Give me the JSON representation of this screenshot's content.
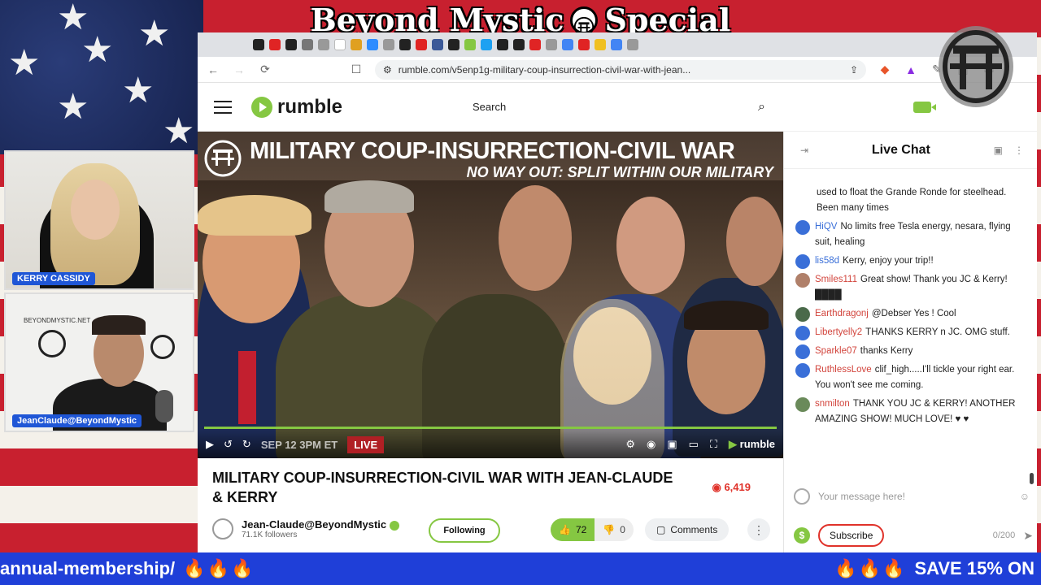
{
  "stream": {
    "title_left": "Beyond Mystic",
    "title_right": "Special Report",
    "ticker_left": "annual-membership/",
    "ticker_left_emoji": "🔥🔥🔥",
    "ticker_right_emoji": "🔥🔥🔥",
    "ticker_right": "SAVE 15% ON"
  },
  "cams": [
    {
      "label": "KERRY CASSIDY"
    },
    {
      "label": "JeanClaude@BeyondMystic",
      "backdrop_text": "BEYONDMYSTIC.NET"
    }
  ],
  "browser": {
    "url": "rumble.com/v5enp1g-military-coup-insurrection-civil-war-with-jean...",
    "nav": {
      "back": "←",
      "forward": "→",
      "reload": "⟳"
    }
  },
  "rumble": {
    "logo": "rumble",
    "search_placeholder": "Search"
  },
  "video": {
    "title": "MILITARY COUP-INSURRECTION-CIVIL WAR",
    "subtitle": "NO WAY OUT: SPLIT WITHIN OUR MILITARY",
    "overlay_date": "SEP 12 3PM ET",
    "live_label": "LIVE",
    "brand": "rumble",
    "progress": 1.0,
    "heading": "MILITARY COUP-INSURRECTION-CIVIL WAR WITH JEAN-CLAUDE & KERRY",
    "views": "6,419",
    "channel": "Jean-Claude@BeyondMystic",
    "followers": "71.1K followers",
    "follow_label": "Following",
    "likes": "72",
    "dislikes": "0",
    "comments_label": "Comments"
  },
  "chat": {
    "title": "Live Chat",
    "input_placeholder": "Your message here!",
    "subscribe_label": "Subscribe",
    "counter": "0/200",
    "messages": [
      {
        "user": "",
        "text": "used to float the Grande Ronde for steelhead. Been many times",
        "color": "#333333",
        "avatar": ""
      },
      {
        "user": "HiQV",
        "text": "No limits free Tesla energy, nesara, flying suit, healing",
        "color": "#3a6fd8",
        "avatar": "#3a6fd8"
      },
      {
        "user": "lis58d",
        "text": "Kerry, enjoy your trip!!",
        "color": "#3a6fd8",
        "avatar": "#3a6fd8"
      },
      {
        "user": "Smiles111",
        "text": "Great show! Thank you JC & Kerry! ████",
        "color": "#d2443c",
        "avatar": "#b0806a"
      },
      {
        "user": "Earthdragonj",
        "text": "@Debser Yes ! Cool",
        "color": "#d2443c",
        "avatar": "#4a6a4a"
      },
      {
        "user": "Libertyelly2",
        "text": "THANKS KERRY n JC. OMG stuff.",
        "color": "#d2443c",
        "avatar": "#3a6fd8"
      },
      {
        "user": "Sparkle07",
        "text": "thanks Kerry",
        "color": "#d2443c",
        "avatar": "#3a6fd8"
      },
      {
        "user": "RuthlessLove",
        "text": "clif_high.....I'll tickle your right ear. You won't see me coming.",
        "color": "#d2443c",
        "avatar": "#3a6fd8"
      },
      {
        "user": "snmilton",
        "text": "THANK YOU JC & KERRY! ANOTHER AMAZING SHOW! MUCH LOVE! ♥ ♥",
        "color": "#d2443c",
        "avatar": "#6a8a5a"
      }
    ]
  }
}
